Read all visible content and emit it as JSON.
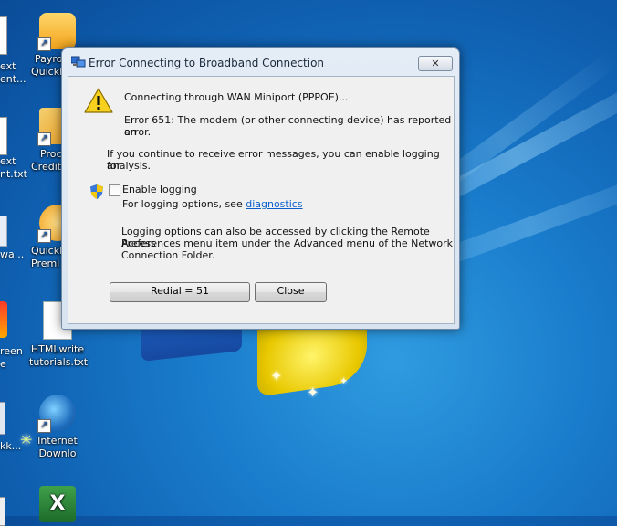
{
  "dialog": {
    "title": "Error Connecting to Broadband Connection",
    "close_label": "✕",
    "connecting_text": "Connecting through WAN Miniport (PPPOE)...",
    "error_text_1": "Error 651: The modem (or other connecting device) has reported an",
    "error_text_2": "error.",
    "logging_hint_1": "If you continue to receive error messages, you can enable logging for",
    "logging_hint_2": "analysis.",
    "enable_logging_label": "Enable logging",
    "enable_logging_checked": false,
    "logging_options_prefix": "For logging options, see ",
    "diagnostics_link": "diagnostics",
    "access_text_1": "Logging options can also be accessed by clicking the Remote Access",
    "access_text_2": "Preferences menu item under the Advanced menu of the Network",
    "access_text_3": "Connection Folder.",
    "redial_button": "Redial = 51",
    "close_button": "Close"
  },
  "desktop": {
    "icons": [
      {
        "line1": "Payro",
        "line2": "Quickb"
      },
      {
        "line1": "Proc",
        "line2": "Credit"
      },
      {
        "line1": "Quickb",
        "line2": "Premi"
      },
      {
        "line1": "HTMLwrite",
        "line2": "tutorials.txt"
      },
      {
        "line1": "Internet",
        "line2": "Downlo"
      }
    ],
    "left_edge": {
      "a1": "ext",
      "a2": "ent...",
      "b1": "ext",
      "b2": "nt.txt",
      "c1": "wa...",
      "d1": "reen",
      "d2": "e",
      "e1": "kk..."
    }
  },
  "colors": {
    "link": "#0b5fcc",
    "desktop_blue": "#1a7ccc"
  }
}
